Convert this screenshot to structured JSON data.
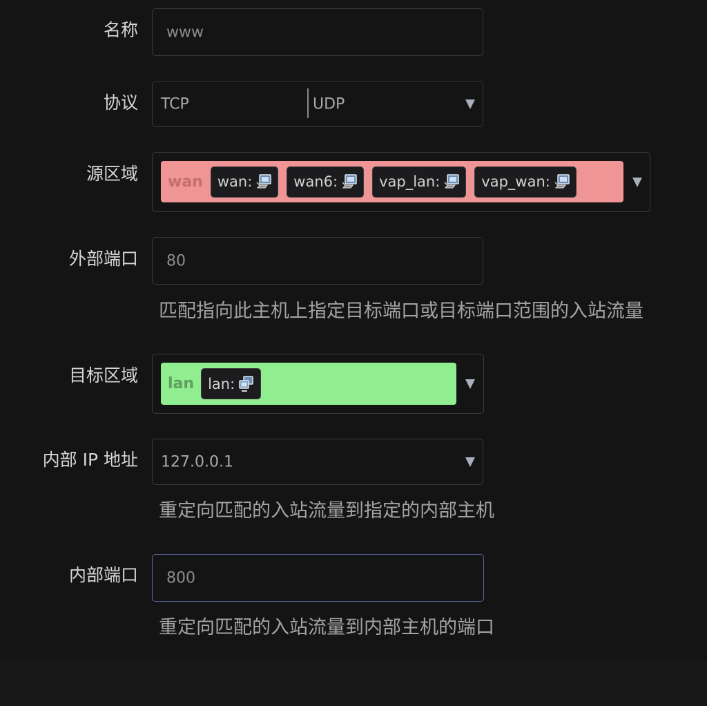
{
  "fields": {
    "name": {
      "label": "名称",
      "value": "www"
    },
    "protocol": {
      "label": "协议",
      "options": [
        "TCP",
        "UDP"
      ]
    },
    "src_zone": {
      "label": "源区域",
      "zone": "wan",
      "zone_color": "#f09595",
      "chips": [
        "wan:",
        "wan6:",
        "vap_lan:",
        "vap_wan:"
      ]
    },
    "ext_port": {
      "label": "外部端口",
      "value": "80",
      "hint": "匹配指向此主机上指定目标端口或目标端口范围的入站流量"
    },
    "dest_zone": {
      "label": "目标区域",
      "zone": "lan",
      "zone_color": "#90ee90",
      "chips": [
        "lan:"
      ]
    },
    "int_ip": {
      "label": "内部 IP 地址",
      "value": "127.0.0.1",
      "hint": "重定向匹配的入站流量到指定的内部主机"
    },
    "int_port": {
      "label": "内部端口",
      "value": "800",
      "hint": "重定向匹配的入站流量到内部主机的端口"
    }
  },
  "icons": {
    "chip_icon": "network-interface-icon",
    "dropdown": "chevron-down-icon"
  },
  "colors": {
    "background": "#141414",
    "focus_border": "#5c64a8"
  }
}
